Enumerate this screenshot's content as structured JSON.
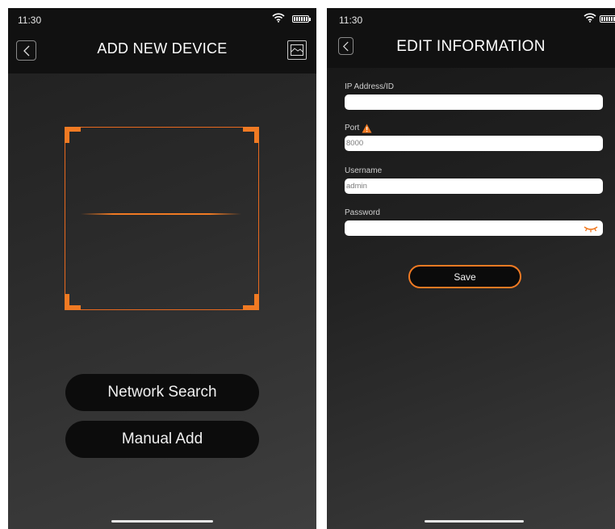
{
  "left_screen": {
    "status": {
      "time": "11:30"
    },
    "nav": {
      "title": "ADD NEW DEVICE"
    },
    "buttons": {
      "network_search": "Network Search",
      "manual_add": "Manual Add"
    }
  },
  "right_screen": {
    "status": {
      "time": "11:30"
    },
    "nav": {
      "title": "EDIT INFORMATION"
    },
    "form": {
      "ip": {
        "label": "IP Address/ID",
        "value": ""
      },
      "port": {
        "label": "Port",
        "value": "8000"
      },
      "username": {
        "label": "Username",
        "value": "admin"
      },
      "password": {
        "label": "Password",
        "value": ""
      }
    },
    "save_label": "Save"
  },
  "colors": {
    "accent": "#f07a23",
    "warning": "#f07a23",
    "navbar": "#111111"
  },
  "icons": {
    "back": "chevron-left-icon",
    "album": "image-icon",
    "wifi": "wifi-icon",
    "battery": "battery-icon",
    "warning": "warning-icon",
    "eye": "eye-closed-icon"
  }
}
